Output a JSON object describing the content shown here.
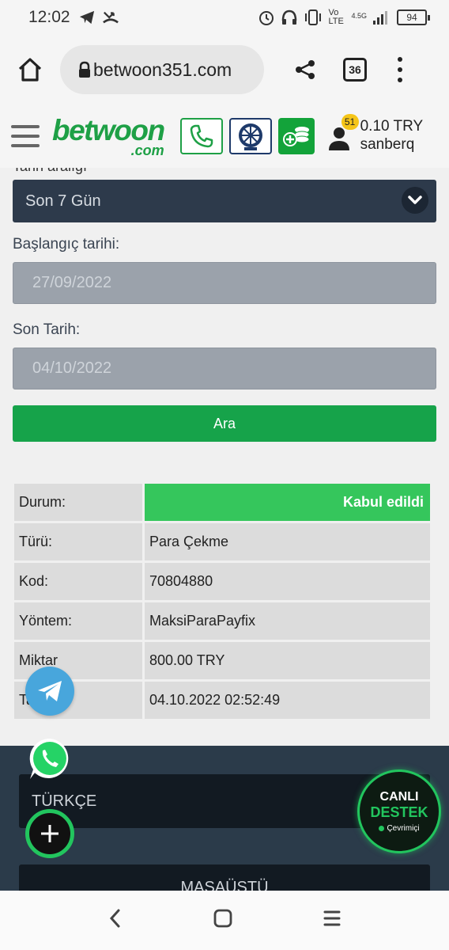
{
  "status_bar": {
    "time": "12:02",
    "battery": "94",
    "network": "Vo LTE",
    "network_gen": "4.5G"
  },
  "browser": {
    "url": "betwoon351.com",
    "tab_count": "36"
  },
  "header": {
    "logo_name": "betwoon",
    "logo_domain": ".com",
    "notification_count": "51",
    "balance": "0.10 TRY",
    "username": "sanberq"
  },
  "filter": {
    "period_label_partial": "Tarih aralığı",
    "period_value": "Son 7 Gün",
    "start_label": "Başlangıç tarihi:",
    "start_value": "27/09/2022",
    "end_label": "Son Tarih:",
    "end_value": "04/10/2022",
    "search_label": "Ara"
  },
  "result": {
    "rows": [
      {
        "key": "Durum:",
        "value": "Kabul edildi"
      },
      {
        "key": "Türü:",
        "value": "Para Çekme"
      },
      {
        "key": "Kod:",
        "value": "70804880"
      },
      {
        "key": "Yöntem:",
        "value": "MaksiParaPayfix"
      },
      {
        "key": "Miktar",
        "value": "800.00 TRY"
      },
      {
        "key": "Tarih",
        "value": "04.10.2022 02:52:49"
      }
    ]
  },
  "footer": {
    "language": "TÜRKÇE",
    "desktop": "MASAÜSTÜ"
  },
  "live_support": {
    "line1": "CANLI",
    "line2": "DESTEK",
    "status": "Çevrimiçi"
  },
  "colors": {
    "brand_green": "#1ea046",
    "status_green": "#35c65c",
    "dark_navy": "#2d3a4b"
  },
  "icons": [
    "home-icon",
    "lock-icon",
    "share-icon",
    "phone-icon",
    "wheel-icon",
    "coins-icon",
    "user-icon",
    "telegram-icon",
    "whatsapp-icon",
    "plus-icon",
    "back-icon",
    "home-nav-icon",
    "recents-icon"
  ]
}
